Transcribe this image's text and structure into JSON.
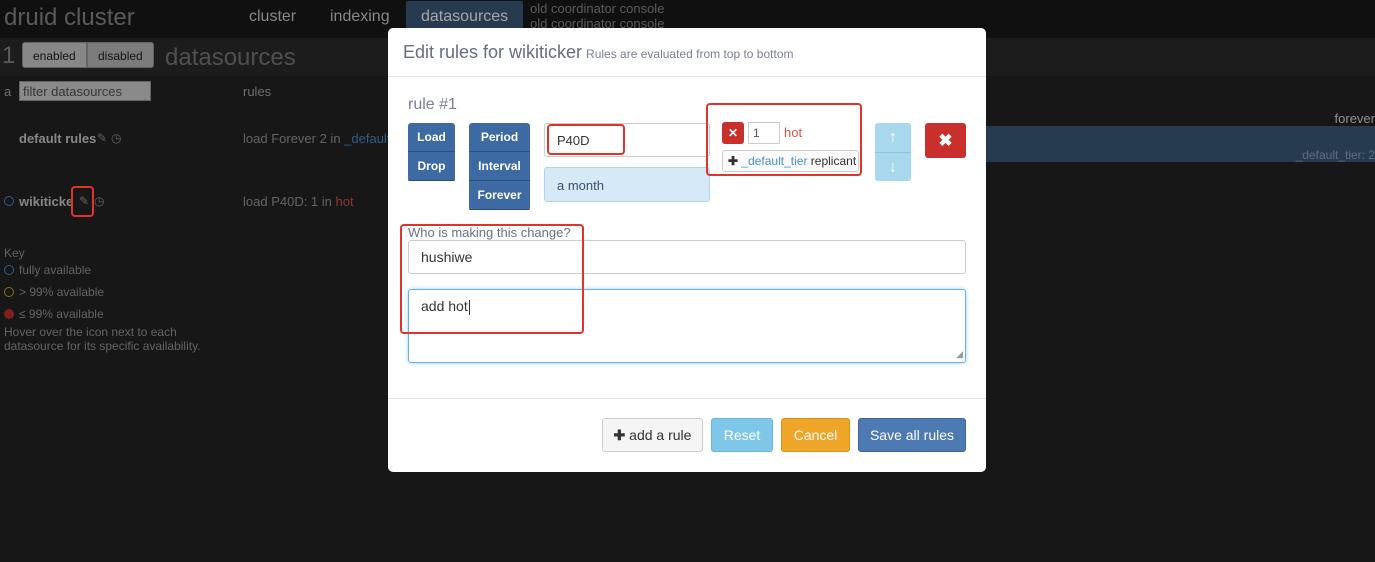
{
  "topnav": {
    "brand": "druid cluster",
    "tabs": [
      {
        "label": "cluster"
      },
      {
        "label": "indexing"
      },
      {
        "label": "datasources"
      }
    ],
    "old_links": [
      "old coordinator console",
      "old coordinator console"
    ]
  },
  "subbar": {
    "count": "1",
    "seg_enabled": "enabled",
    "seg_disabled": "disabled",
    "title": "datasources"
  },
  "table": {
    "col_a": "a",
    "filter_placeholder": "filter datasources",
    "rules_header": "rules",
    "rows": [
      {
        "name": "default rules",
        "rules_prefix": "load Forever 2 in ",
        "rules_tier": "_default"
      },
      {
        "name": "wikiticker",
        "rules_prefix": "load P40D: 1 in ",
        "rules_tier": "hot"
      }
    ],
    "right_forever": "forever",
    "right_tier": "_default_tier: 2"
  },
  "key": {
    "title": "Key",
    "items": [
      "fully available",
      "> 99% available",
      "≤ 99% available"
    ],
    "note": "Hover over the icon next to each datasource for its specific availability."
  },
  "modal": {
    "title": "Edit rules for wikiticker",
    "subtitle": "Rules are evaluated from top to bottom",
    "rule_title": "rule #1",
    "action_buttons": [
      "Load",
      "Drop"
    ],
    "type_buttons": [
      "Period",
      "Interval",
      "Forever"
    ],
    "period_value": "P40D",
    "period_hint": "a month",
    "tier": {
      "replicants": "1",
      "tier_name": "hot",
      "add_tier_link": "_default_tier",
      "add_tier_label": "replicant"
    },
    "who_label": "Who is making this change?",
    "who_value": "hushiwe",
    "comment_value": "add hot",
    "buttons": {
      "add_rule": "add a rule",
      "reset": "Reset",
      "cancel": "Cancel",
      "save": "Save all rules"
    }
  },
  "colors": {
    "primary": "#3e6aa3",
    "danger": "#c9302c",
    "info": "#7fc7e8",
    "warning": "#eea528",
    "highlight": "#e0332b"
  }
}
